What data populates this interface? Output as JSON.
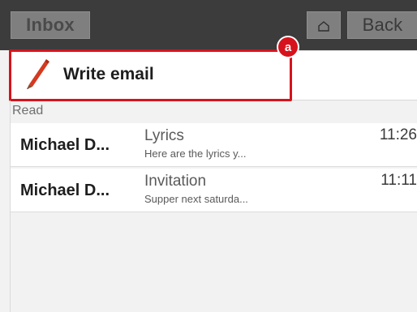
{
  "topbar": {
    "inbox_label": "Inbox",
    "home_icon": "home-icon",
    "back_label": "Back"
  },
  "compose": {
    "label": "Write email",
    "icon": "pencil-icon",
    "badge": "a",
    "highlight_color": "#d6131c"
  },
  "sections": {
    "read_label": "Read"
  },
  "messages": [
    {
      "sender": "Michael D...",
      "subject": "Lyrics",
      "preview": "Here are the lyrics y...",
      "time": "11:26"
    },
    {
      "sender": "Michael D...",
      "subject": "Invitation",
      "preview": "Supper next saturda...",
      "time": "11:11"
    }
  ],
  "colors": {
    "topbar_bg": "#3c3c3c",
    "button_bg": "#7f7f7f",
    "list_bg": "#f2f2f2",
    "accent_red": "#d6131c"
  }
}
